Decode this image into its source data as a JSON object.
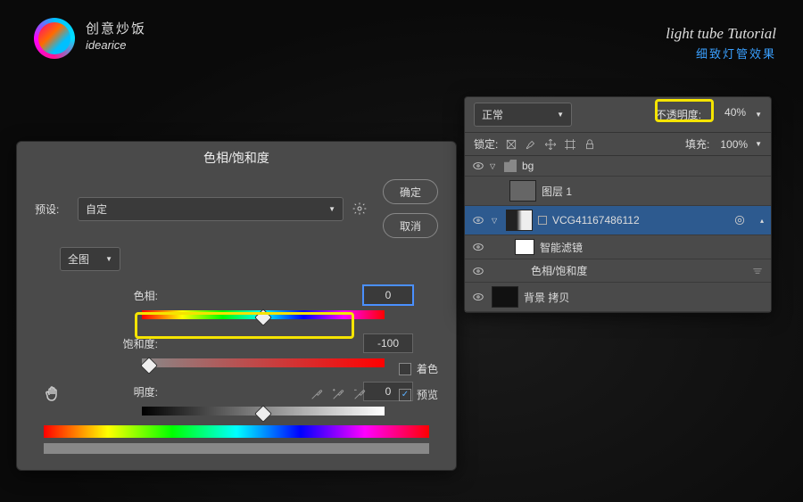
{
  "brand": {
    "cn": "创意炒饭",
    "en": "idearice"
  },
  "tutorial": {
    "title": "light tube Tutorial",
    "sub": "细致灯管效果"
  },
  "dialog": {
    "title": "色相/饱和度",
    "preset_label": "预设:",
    "preset_value": "自定",
    "ok": "确定",
    "cancel": "取消",
    "master": "全图",
    "hue_label": "色相:",
    "hue_value": "0",
    "sat_label": "饱和度:",
    "sat_value": "-100",
    "light_label": "明度:",
    "light_value": "0",
    "colorize": "着色",
    "preview": "预览"
  },
  "panel": {
    "blend_mode": "正常",
    "opacity_label": "不透明度:",
    "opacity_value": "40%",
    "lock_label": "锁定:",
    "fill_label": "填充:",
    "fill_value": "100%",
    "layers": {
      "group": "bg",
      "layer0": "图层 1",
      "layer1": "VCG41167486112",
      "smart_filters": "智能滤镜",
      "filter1": "色相/饱和度",
      "bg_copy": "背景 拷贝"
    }
  }
}
